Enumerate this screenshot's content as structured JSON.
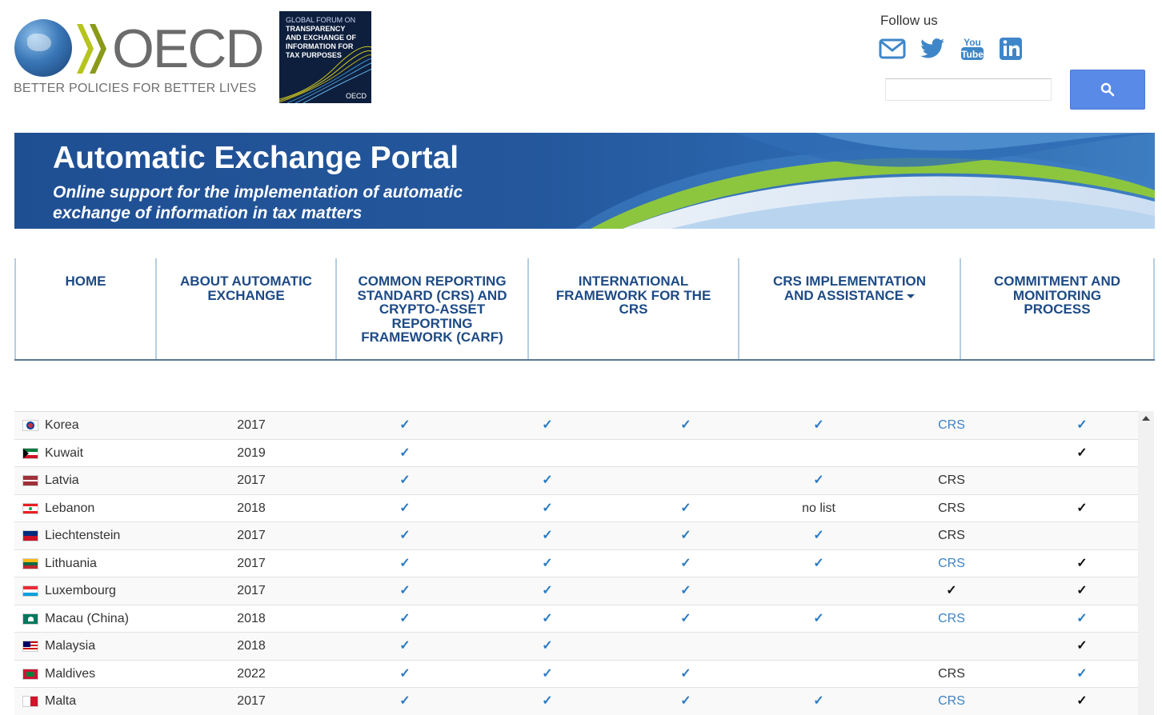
{
  "header": {
    "logo_word": "OECD",
    "logo_tagline": "BETTER POLICIES FOR BETTER LIVES",
    "global_forum_lines": [
      "GLOBAL FORUM ON",
      "TRANSPARENCY",
      "AND EXCHANGE OF",
      "INFORMATION FOR",
      "TAX PURPOSES"
    ],
    "global_forum_mark": "OECD",
    "follow_us": "Follow us",
    "social_icons": [
      "mail-icon",
      "twitter-icon",
      "youtube-icon",
      "linkedin-icon"
    ],
    "search_placeholder": ""
  },
  "banner": {
    "title": "Automatic Exchange Portal",
    "subtitle": "Online support for the implementation of automatic exchange of information in tax matters"
  },
  "nav": {
    "items": [
      {
        "label": "HOME"
      },
      {
        "label": "ABOUT AUTOMATIC EXCHANGE"
      },
      {
        "label": "COMMON REPORTING STANDARD (CRS) AND CRYPTO-ASSET REPORTING FRAMEWORK (CARF)"
      },
      {
        "label": "INTERNATIONAL FRAMEWORK FOR THE CRS"
      },
      {
        "label": "CRS IMPLEMENTATION AND ASSISTANCE"
      },
      {
        "label": "COMMITMENT AND MONITORING PROCESS"
      }
    ]
  },
  "table": {
    "rows": [
      {
        "country": "Korea",
        "flag": "korea",
        "year": "2017",
        "c1": "✓",
        "c2": "✓",
        "c3": "✓",
        "c4": "✓",
        "c5": "CRS",
        "c5_link": true,
        "c6": "✓",
        "c6_blue": true
      },
      {
        "country": "Kuwait",
        "flag": "kuwait",
        "year": "2019",
        "c1": "✓",
        "c2": "",
        "c3": "",
        "c4": "",
        "c5": "",
        "c5_link": false,
        "c6": "✓",
        "c6_blue": false
      },
      {
        "country": "Latvia",
        "flag": "latvia",
        "year": "2017",
        "c1": "✓",
        "c2": "✓",
        "c3": "",
        "c4": "✓",
        "c5": "CRS",
        "c5_link": false,
        "c6": "",
        "c6_blue": false
      },
      {
        "country": "Lebanon",
        "flag": "lebanon",
        "year": "2018",
        "c1": "✓",
        "c2": "✓",
        "c3": "✓",
        "c4": "no list",
        "c5": "CRS",
        "c5_link": false,
        "c6": "✓",
        "c6_blue": false
      },
      {
        "country": "Liechtenstein",
        "flag": "liechtenstein",
        "year": "2017",
        "c1": "✓",
        "c2": "✓",
        "c3": "✓",
        "c4": "✓",
        "c5": "CRS",
        "c5_link": false,
        "c6": "",
        "c6_blue": false
      },
      {
        "country": "Lithuania",
        "flag": "lithuania",
        "year": "2017",
        "c1": "✓",
        "c2": "✓",
        "c3": "✓",
        "c4": "✓",
        "c5": "CRS",
        "c5_link": true,
        "c6": "✓",
        "c6_blue": false
      },
      {
        "country": "Luxembourg",
        "flag": "luxembourg",
        "year": "2017",
        "c1": "✓",
        "c2": "✓",
        "c3": "✓",
        "c4": "",
        "c5": "✓",
        "c5_link": false,
        "c6": "✓",
        "c6_blue": false
      },
      {
        "country": "Macau (China)",
        "flag": "macau",
        "year": "2018",
        "c1": "✓",
        "c2": "✓",
        "c3": "✓",
        "c4": "✓",
        "c5": "CRS",
        "c5_link": true,
        "c6": "✓",
        "c6_blue": true
      },
      {
        "country": "Malaysia",
        "flag": "malaysia",
        "year": "2018",
        "c1": "✓",
        "c2": "✓",
        "c3": "",
        "c4": "",
        "c5": "",
        "c5_link": false,
        "c6": "✓",
        "c6_blue": false
      },
      {
        "country": "Maldives",
        "flag": "maldives",
        "year": "2022",
        "c1": "✓",
        "c2": "✓",
        "c3": "✓",
        "c4": "",
        "c5": "CRS",
        "c5_link": false,
        "c6": "✓",
        "c6_blue": true
      },
      {
        "country": "Malta",
        "flag": "malta",
        "year": "2017",
        "c1": "✓",
        "c2": "✓",
        "c3": "✓",
        "c4": "✓",
        "c5": "CRS",
        "c5_link": true,
        "c6": "✓",
        "c6_blue": false
      }
    ]
  },
  "colors": {
    "nav_text": "#1d4a85",
    "banner_blue": "#24579c",
    "check_blue": "#2a7bc2",
    "link_blue": "#3d83c6",
    "search_button": "#5a8ae8"
  }
}
